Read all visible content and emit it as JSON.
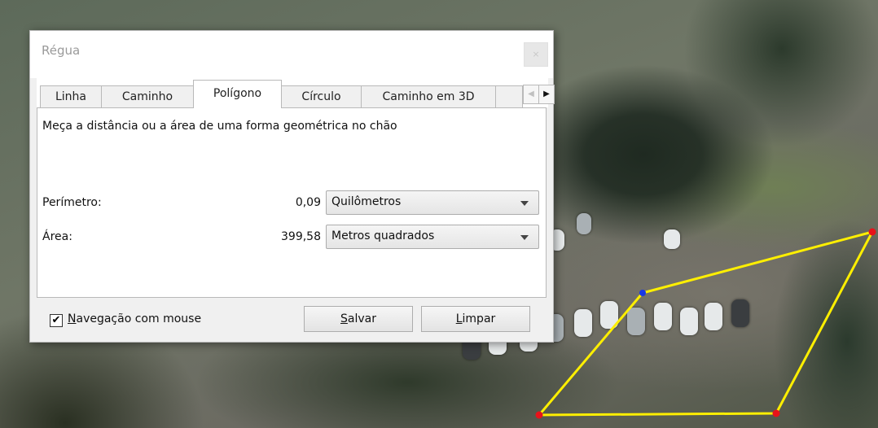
{
  "dialog": {
    "title": "Régua",
    "close_glyph": "×",
    "tabs": [
      {
        "label": "Linha"
      },
      {
        "label": "Caminho"
      },
      {
        "label": "Polígono"
      },
      {
        "label": "Círculo"
      },
      {
        "label": "Caminho em 3D"
      }
    ],
    "active_tab": "Polígono",
    "tab_scroll_left_glyph": "◀",
    "tab_scroll_right_glyph": "▶",
    "description": "Meça a distância ou a área de uma forma geométrica no chão",
    "perimeter": {
      "label": "Perímetro:",
      "value": "0,09",
      "unit": "Quilômetros"
    },
    "area": {
      "label": "Área:",
      "value": "399,58",
      "unit": "Metros quadrados"
    },
    "mouse_navigation": {
      "checked": true,
      "check_glyph": "✔",
      "label_accel": "N",
      "label_rest": "avegação com mouse"
    },
    "save_button": {
      "accel": "S",
      "rest": "alvar"
    },
    "clear_button": {
      "accel": "L",
      "rest": "impar"
    }
  },
  "map": {
    "polygon_line_color": "#ffef00",
    "vertex_color": "#e8121a",
    "active_vertex_color": "#1838e8"
  }
}
